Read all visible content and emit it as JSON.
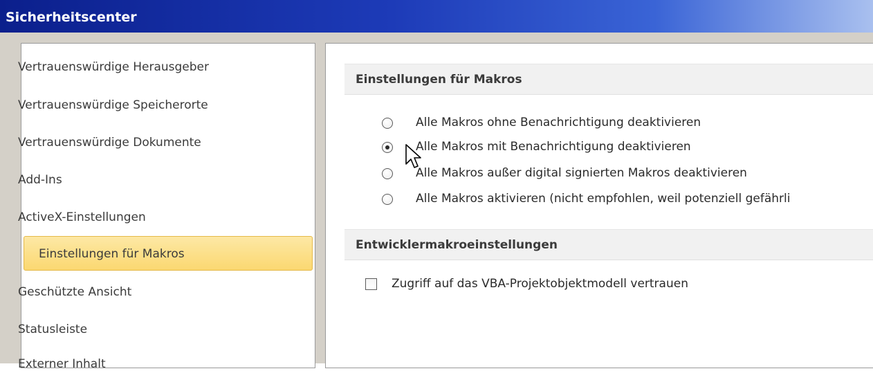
{
  "window": {
    "title": "Sicherheitscenter"
  },
  "sidebar": {
    "items": [
      {
        "label": "Vertrauenswürdige Herausgeber"
      },
      {
        "label": "Vertrauenswürdige Speicherorte"
      },
      {
        "label": "Vertrauenswürdige Dokumente"
      },
      {
        "label": "Add-Ins"
      },
      {
        "label": "ActiveX-Einstellungen"
      },
      {
        "label": "Einstellungen für Makros",
        "selected": true
      },
      {
        "label": "Geschützte Ansicht"
      },
      {
        "label": "Statusleiste"
      },
      {
        "label": "Externer Inhalt"
      }
    ]
  },
  "main": {
    "macro_section": {
      "header": "Einstellungen für Makros",
      "options": [
        {
          "label": "Alle Makros ohne Benachrichtigung deaktivieren",
          "checked": false
        },
        {
          "label": "Alle Makros mit Benachrichtigung deaktivieren",
          "checked": true
        },
        {
          "label": "Alle Makros außer digital signierten Makros deaktivieren",
          "checked": false
        },
        {
          "label": "Alle Makros aktivieren (nicht empfohlen, weil potenziell gefährli",
          "checked": false
        }
      ]
    },
    "developer_section": {
      "header": "Entwicklermakroeinstellungen",
      "checkbox_label": "Zugriff auf das VBA-Projektobjektmodell vertrauen",
      "checkbox_checked": false
    }
  },
  "colors": {
    "title_bar_start": "#0b1f8c",
    "selected_item_bg": "#fbd871",
    "selected_item_border": "#e5b94a",
    "section_header_bg": "#f1f1f1"
  }
}
